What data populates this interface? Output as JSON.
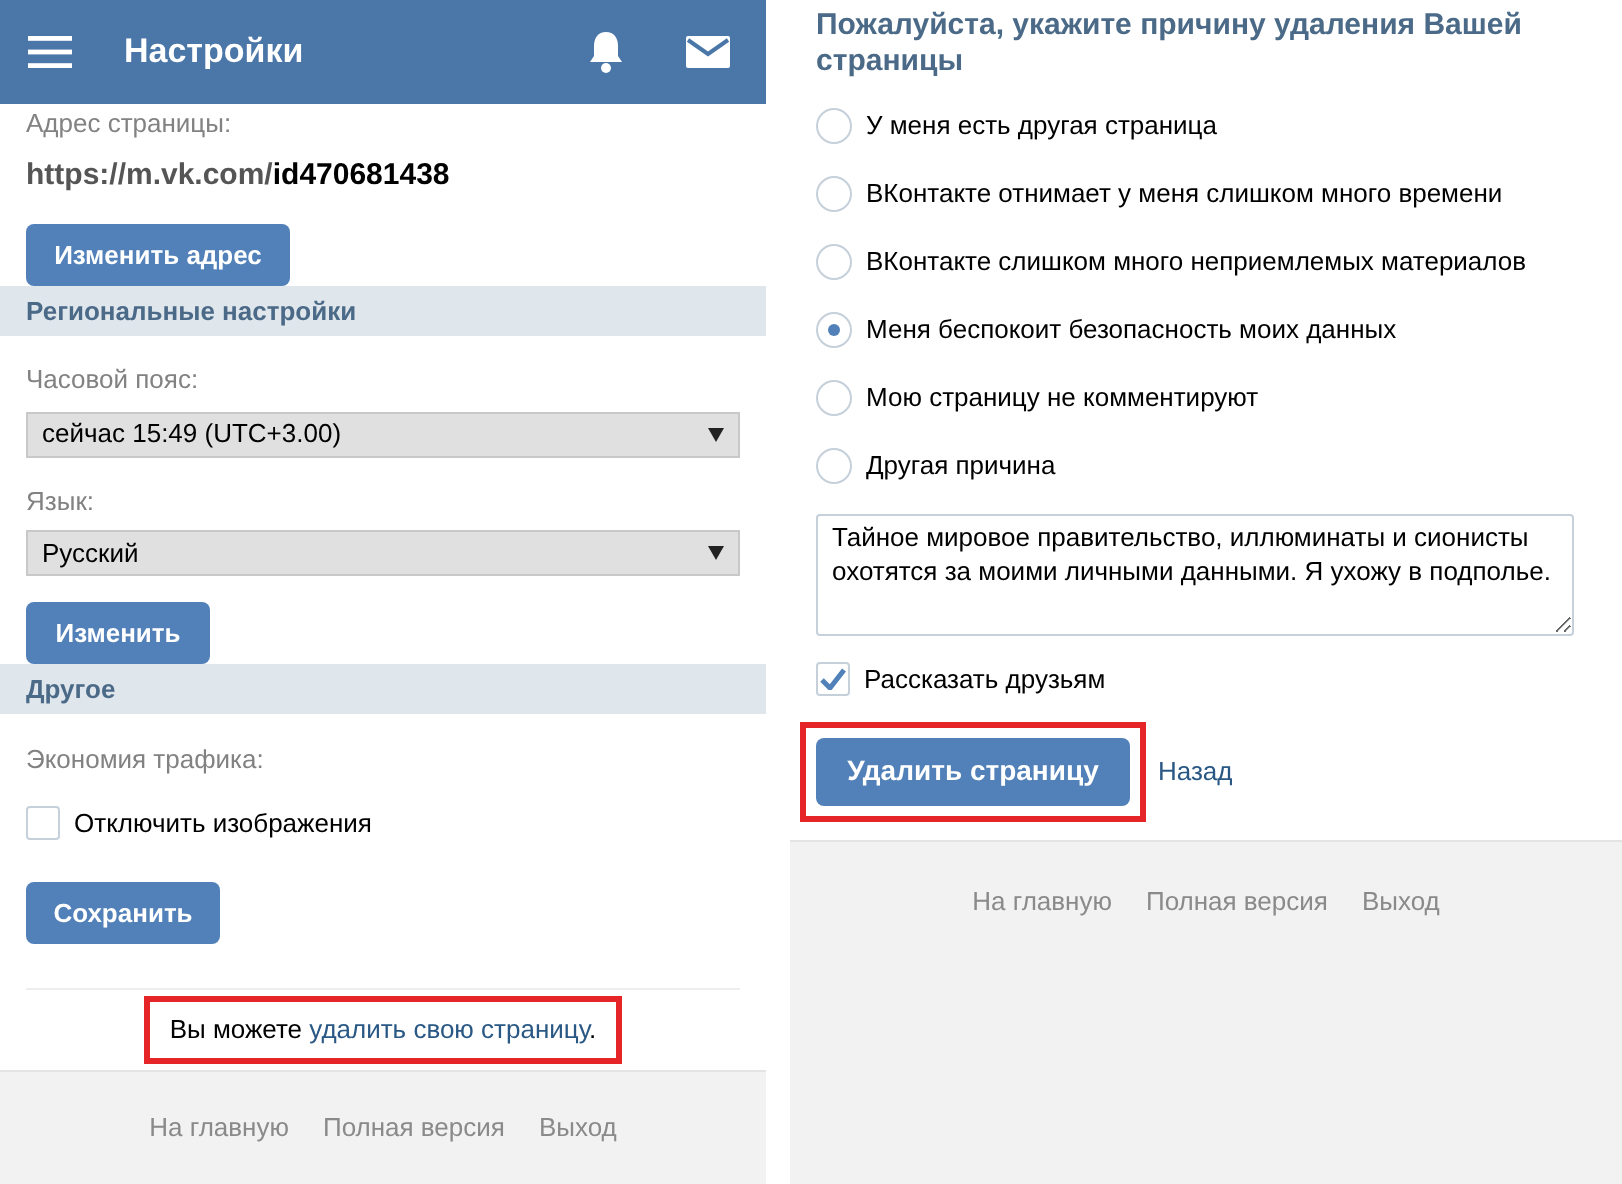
{
  "settings_screen": {
    "header": {
      "title": "Настройки"
    },
    "address": {
      "label": "Адрес страницы:",
      "url_prefix": "https://m.vk.com/",
      "url_id": "id470681438",
      "button": "Изменить адрес"
    },
    "regional": {
      "heading": "Региональные настройки",
      "timezone_label": "Часовой пояс:",
      "timezone_value": "сейчас 15:49 (UTC+3.00)",
      "language_label": "Язык:",
      "language_value": "Русский",
      "button": "Изменить"
    },
    "other": {
      "heading": "Другое",
      "traffic_label": "Экономия трафика:",
      "checkbox": {
        "label": "Отключить изображения",
        "checked": false
      },
      "button": "Сохранить"
    },
    "delete_note": {
      "text": "Вы можете ",
      "link": "удалить свою страницу",
      "end": ".",
      "highlighted": true
    },
    "footer": [
      "На главную",
      "Полная версия",
      "Выход"
    ]
  },
  "delete_screen": {
    "title": "Пожалуйста, укажите причину удаления Вашей страницы",
    "reasons": [
      {
        "label": "У меня есть другая страница",
        "selected": false
      },
      {
        "label": "ВКонтакте отнимает у меня слишком много времени",
        "selected": false
      },
      {
        "label": "ВКонтакте слишком много неприемлемых материалов",
        "selected": false
      },
      {
        "label": "Меня беспокоит безопасность моих данных",
        "selected": true
      },
      {
        "label": "Мою страницу не комментируют",
        "selected": false
      },
      {
        "label": "Другая причина",
        "selected": false
      }
    ],
    "comment": "Тайное мировое правительство, иллюминаты и сионисты охотятся за моими личными данными. Я ухожу в подполье.",
    "tell_friends": {
      "label": "Рассказать друзьям",
      "checked": true
    },
    "delete_button": {
      "label": "Удалить страницу",
      "highlighted": true
    },
    "back_link": "Назад",
    "footer": [
      "На главную",
      "Полная версия",
      "Выход"
    ]
  }
}
